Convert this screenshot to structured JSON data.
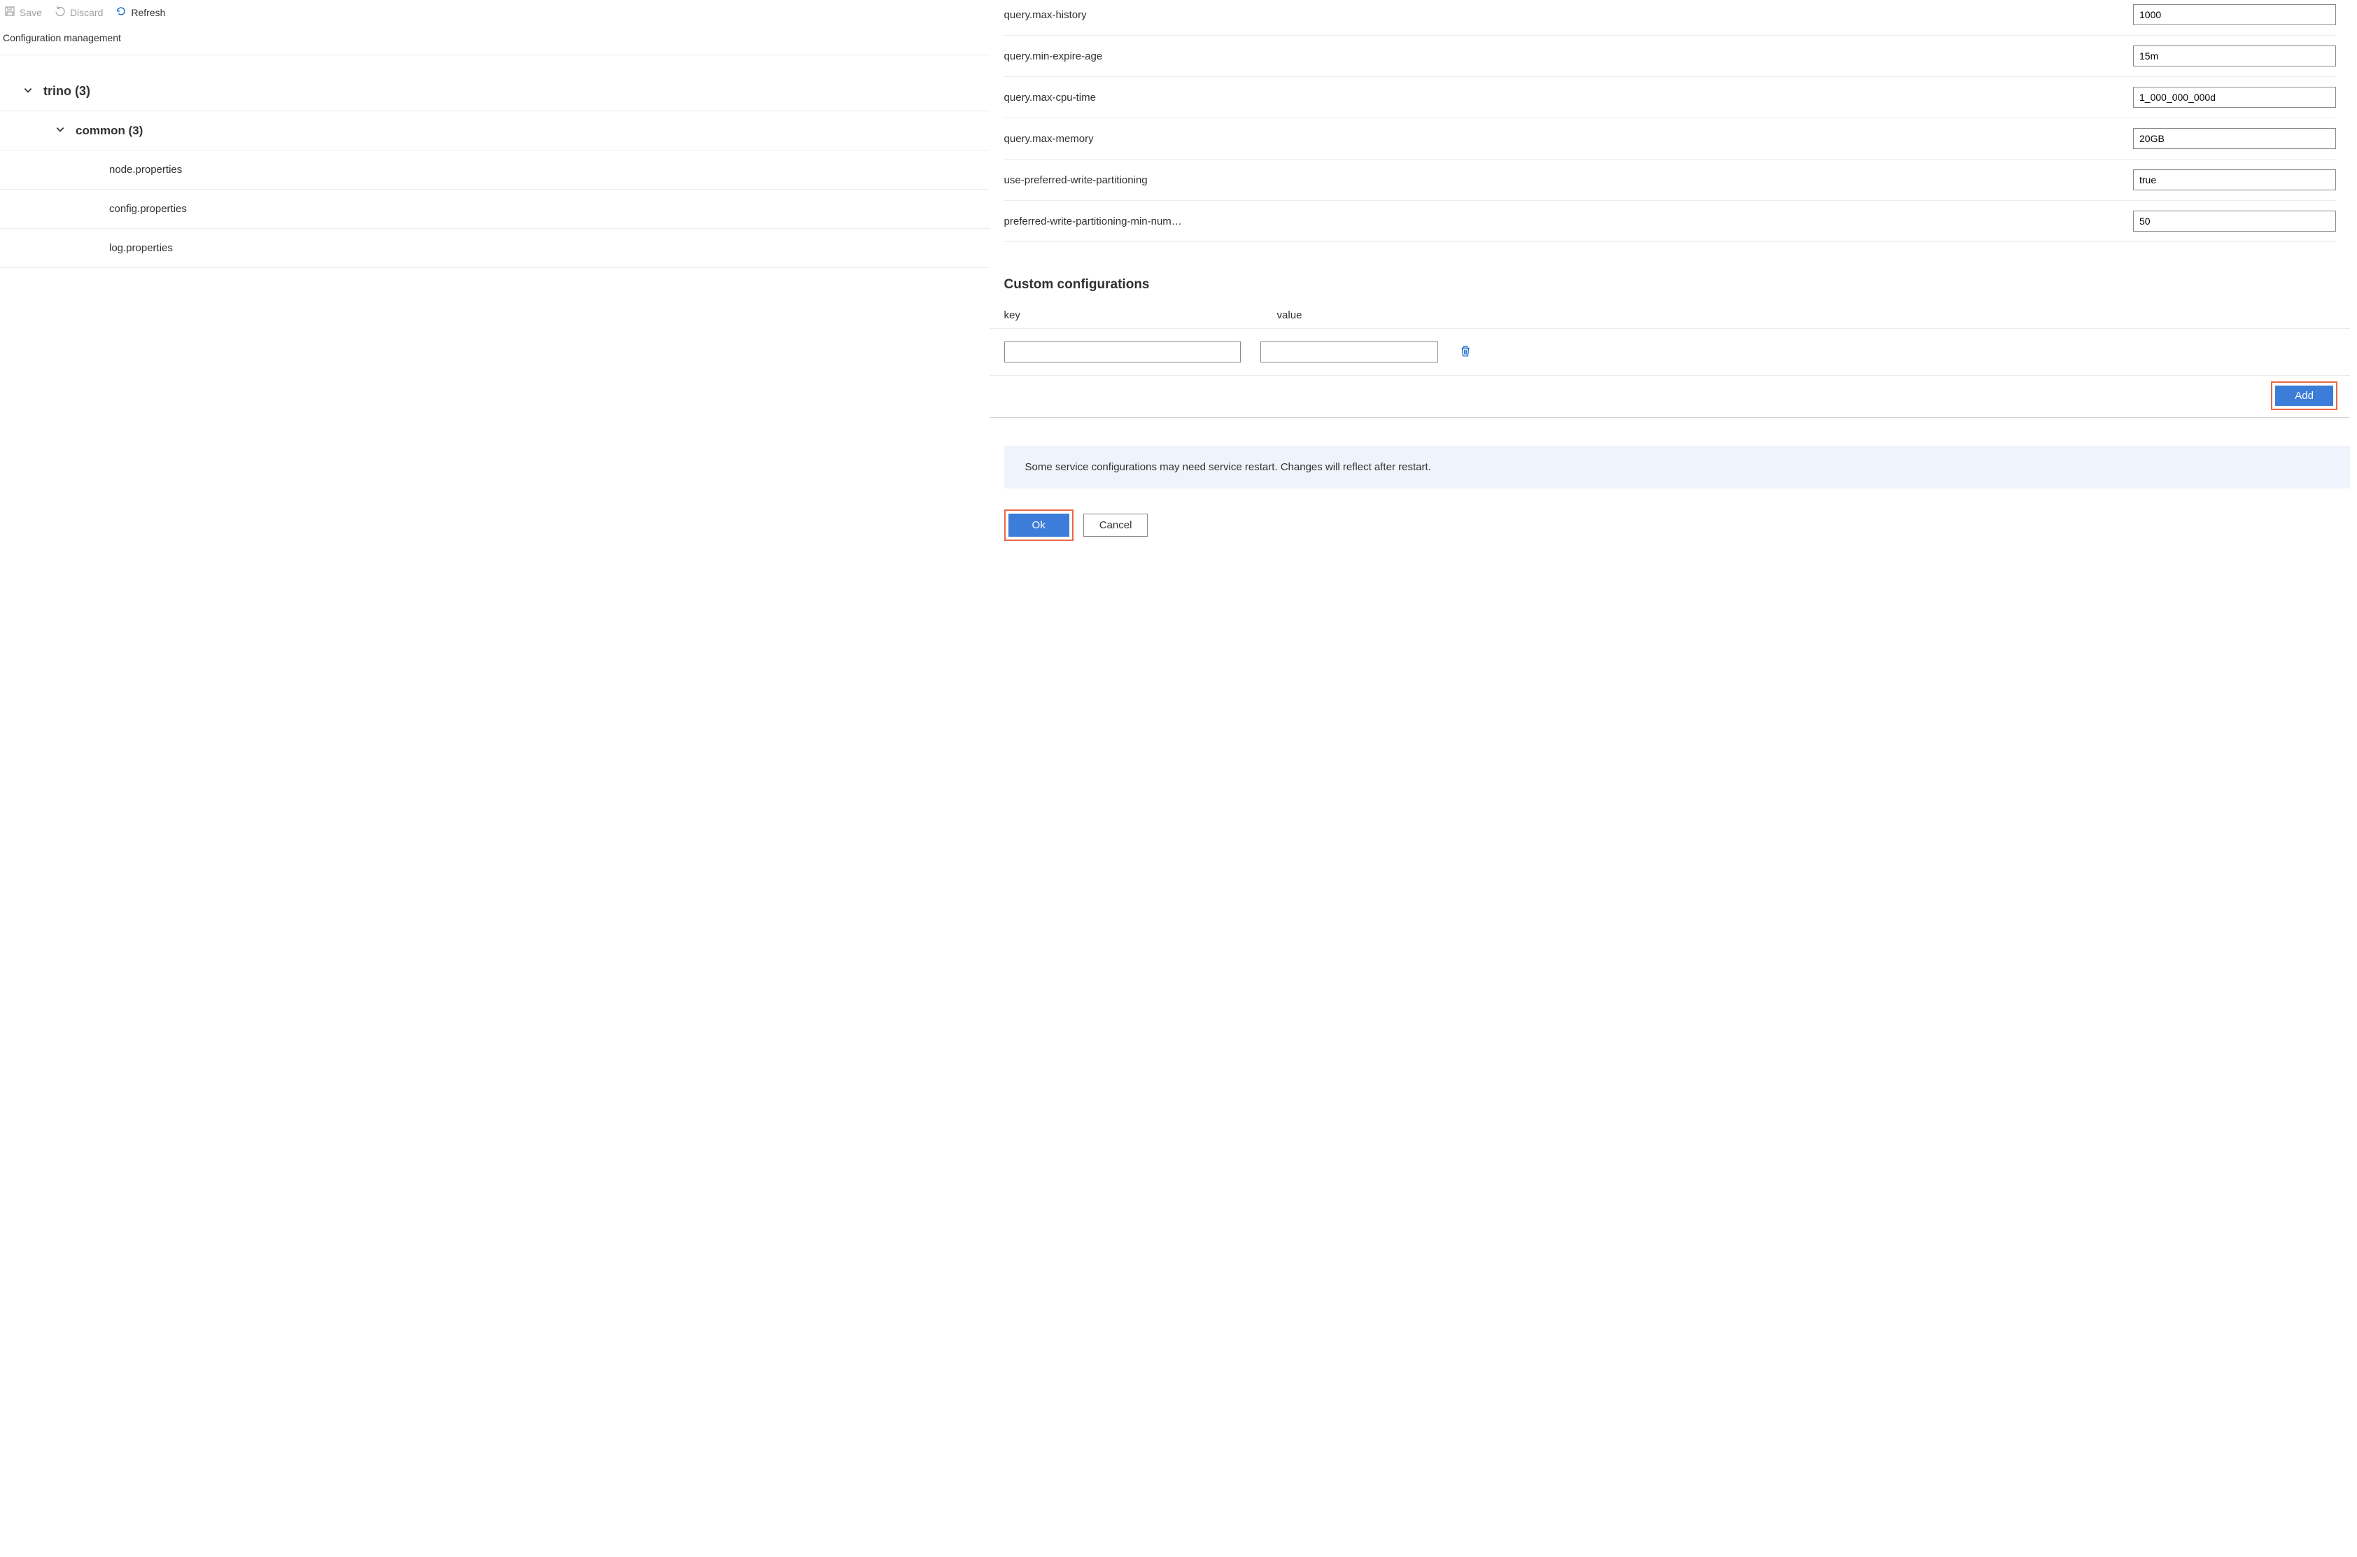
{
  "toolbar": {
    "save_label": "Save",
    "discard_label": "Discard",
    "refresh_label": "Refresh"
  },
  "page": {
    "subtitle": "Configuration management"
  },
  "tree": {
    "root": {
      "label": "trino (3)"
    },
    "group": {
      "label": "common (3)"
    },
    "leaves": [
      {
        "label": "node.properties"
      },
      {
        "label": "config.properties"
      },
      {
        "label": "log.properties"
      }
    ]
  },
  "settings": [
    {
      "key": "query.max-history",
      "value": "1000"
    },
    {
      "key": "query.min-expire-age",
      "value": "15m"
    },
    {
      "key": "query.max-cpu-time",
      "value": "1_000_000_000d"
    },
    {
      "key": "query.max-memory",
      "value": "20GB"
    },
    {
      "key": "use-preferred-write-partitioning",
      "value": "true"
    },
    {
      "key": "preferred-write-partitioning-min-num…",
      "value": "50"
    }
  ],
  "custom": {
    "heading": "Custom configurations",
    "columns": {
      "key": "key",
      "value": "value"
    },
    "row": {
      "key": "",
      "value": ""
    },
    "add_label": "Add"
  },
  "notice": "Some service configurations may need service restart. Changes will reflect after restart.",
  "footer": {
    "ok_label": "Ok",
    "cancel_label": "Cancel"
  }
}
